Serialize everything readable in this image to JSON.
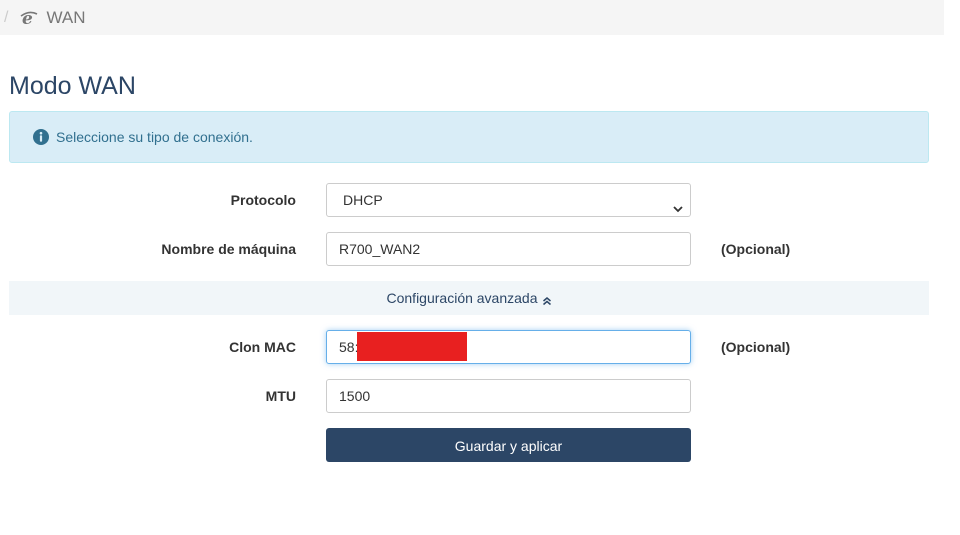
{
  "breadcrumb": {
    "separator": "/",
    "icon": "ie-icon",
    "current": "WAN"
  },
  "page": {
    "title": "Modo WAN"
  },
  "alert": {
    "icon": "info-circle-icon",
    "text": "Seleccione su tipo de conexión."
  },
  "form": {
    "protocol": {
      "label": "Protocolo",
      "value": "DHCP"
    },
    "hostname": {
      "label": "Nombre de máquina",
      "value": "R700_WAN2",
      "note": "(Opcional)"
    },
    "advanced": {
      "label": "Configuración avanzada",
      "icon": "double-chevron-up-icon"
    },
    "mac_clone": {
      "label": "Clon MAC",
      "value": "58:",
      "note": "(Opcional)"
    },
    "mtu": {
      "label": "MTU",
      "value": "1500"
    },
    "save_label": "Guardar y aplicar"
  },
  "colors": {
    "primary": "#2c4666",
    "alert_bg": "#d9edf7",
    "alert_text": "#31708f",
    "redaction": "#e82020"
  }
}
